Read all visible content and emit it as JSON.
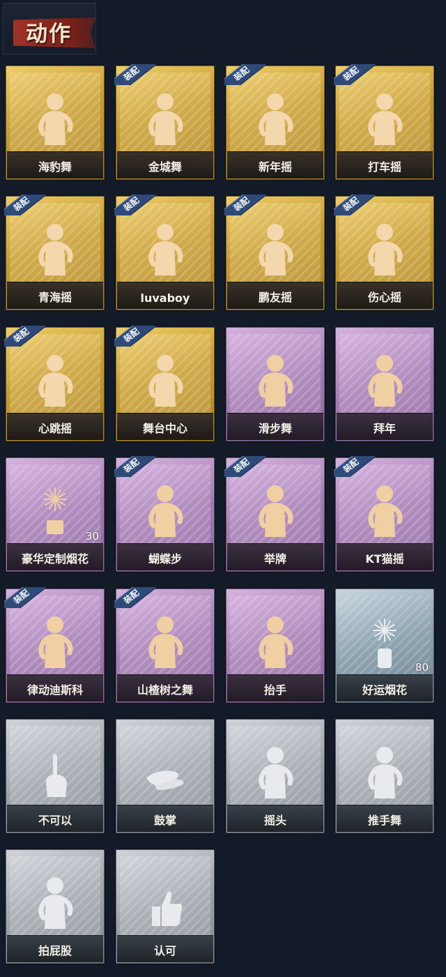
{
  "header": {
    "title": "动作"
  },
  "equip_badge": "装配",
  "cards": [
    {
      "label": "海豹舞",
      "theme": "gold",
      "equipped": false,
      "icon": "figure-dance-icon"
    },
    {
      "label": "金城舞",
      "theme": "gold",
      "equipped": true,
      "icon": "figure-wave-icon"
    },
    {
      "label": "新年摇",
      "theme": "gold",
      "equipped": true,
      "icon": "figure-clap-icon"
    },
    {
      "label": "打车摇",
      "theme": "gold",
      "equipped": true,
      "icon": "figure-point-icon"
    },
    {
      "label": "青海摇",
      "theme": "gold",
      "equipped": true,
      "icon": "figure-shake-icon"
    },
    {
      "label": "luvaboy",
      "theme": "gold",
      "equipped": true,
      "icon": "figure-arm-icon"
    },
    {
      "label": "鹏友摇",
      "theme": "gold",
      "equipped": true,
      "icon": "figure-cross-icon"
    },
    {
      "label": "伤心摇",
      "theme": "gold",
      "equipped": true,
      "icon": "figure-heart-icon"
    },
    {
      "label": "心跳摇",
      "theme": "gold",
      "equipped": true,
      "icon": "figure-reach-icon"
    },
    {
      "label": "舞台中心",
      "theme": "gold",
      "equipped": true,
      "icon": "figure-pose-icon"
    },
    {
      "label": "滑步舞",
      "theme": "purple",
      "equipped": false,
      "icon": "figure-slide-icon"
    },
    {
      "label": "拜年",
      "theme": "purple",
      "equipped": false,
      "icon": "figure-bow-icon"
    },
    {
      "label": "豪华定制烟花",
      "theme": "purple",
      "equipped": false,
      "icon": "fireworks-box-icon",
      "count": "30"
    },
    {
      "label": "蝴蝶步",
      "theme": "purple",
      "equipped": true,
      "icon": "figure-arm-out-icon"
    },
    {
      "label": "举牌",
      "theme": "purple",
      "equipped": true,
      "icon": "figure-sign-icon"
    },
    {
      "label": "KT猫摇",
      "theme": "purple",
      "equipped": true,
      "icon": "figure-music-icon"
    },
    {
      "label": "律动迪斯科",
      "theme": "purple",
      "equipped": true,
      "icon": "figure-disco-icon"
    },
    {
      "label": "山楂树之舞",
      "theme": "purple",
      "equipped": true,
      "icon": "figure-raise-icon"
    },
    {
      "label": "抬手",
      "theme": "purple",
      "equipped": false,
      "icon": "figure-lift-hand-icon"
    },
    {
      "label": "好运烟花",
      "theme": "blue",
      "equipped": false,
      "icon": "fireworks-can-icon",
      "count": "80"
    },
    {
      "label": "不可以",
      "theme": "silver",
      "equipped": false,
      "icon": "finger-wag-icon"
    },
    {
      "label": "鼓掌",
      "theme": "silver",
      "equipped": false,
      "icon": "clap-hands-icon"
    },
    {
      "label": "摇头",
      "theme": "silver",
      "equipped": false,
      "icon": "figure-head-shake-icon"
    },
    {
      "label": "推手舞",
      "theme": "silver",
      "equipped": false,
      "icon": "figure-push-icon"
    },
    {
      "label": "拍屁股",
      "theme": "silver",
      "equipped": false,
      "icon": "figure-slap-icon"
    },
    {
      "label": "认可",
      "theme": "silver",
      "equipped": false,
      "icon": "thumbs-up-icon"
    }
  ]
}
